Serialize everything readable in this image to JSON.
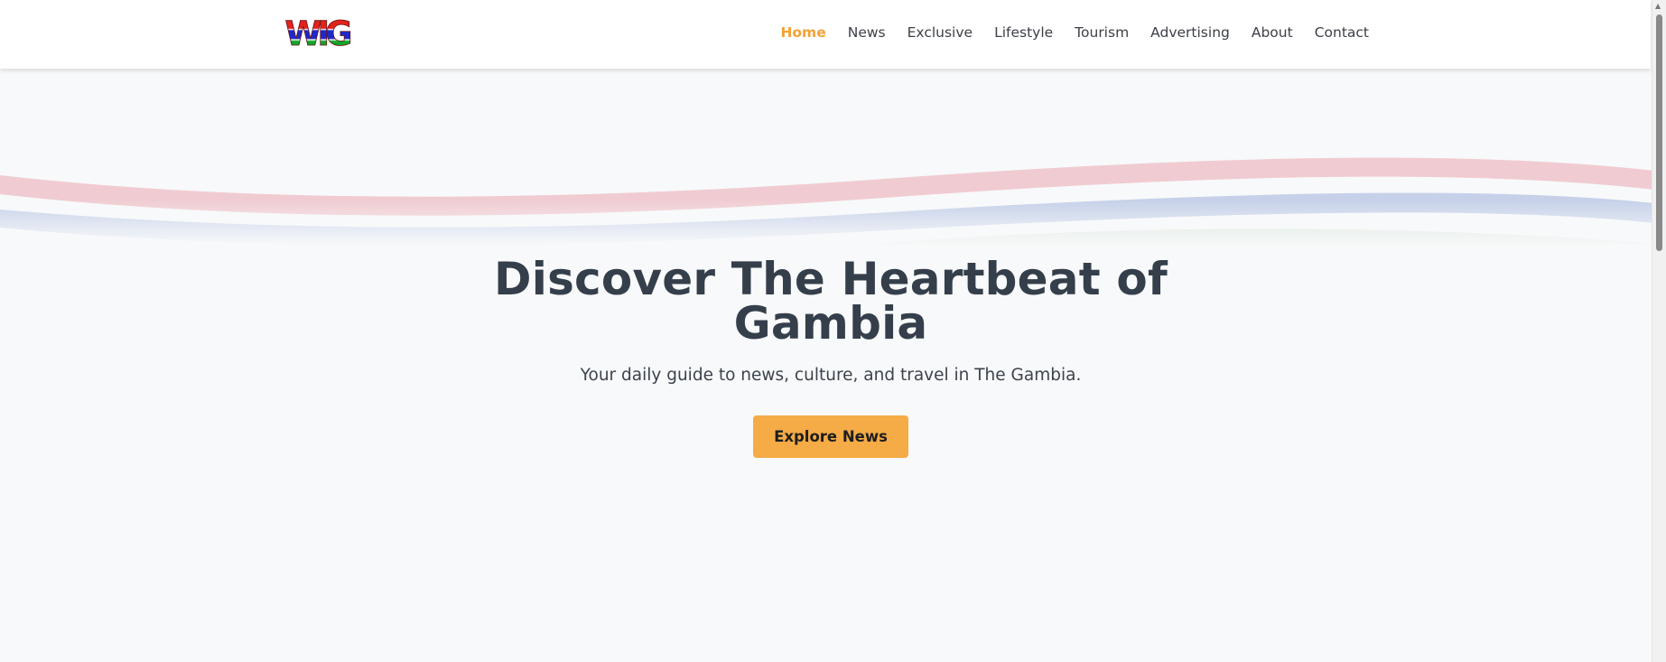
{
  "logo": {
    "text": "WIG",
    "colors": {
      "red": "#e0231b",
      "blue": "#1f29c8",
      "green": "#14a52a"
    }
  },
  "nav": {
    "items": [
      {
        "label": "Home",
        "active": true
      },
      {
        "label": "News",
        "active": false
      },
      {
        "label": "Exclusive",
        "active": false
      },
      {
        "label": "Lifestyle",
        "active": false
      },
      {
        "label": "Tourism",
        "active": false
      },
      {
        "label": "Advertising",
        "active": false
      },
      {
        "label": "About",
        "active": false
      },
      {
        "label": "Contact",
        "active": false
      }
    ]
  },
  "hero": {
    "title": "Discover The Heartbeat of Gambia",
    "subtitle": "Your daily guide to news, culture, and travel in The Gambia.",
    "cta_label": "Explore News"
  },
  "colors": {
    "accent": "#f4a236",
    "button": "#f5ab46",
    "wave_red": "#f0ccd2",
    "wave_blue": "#c6d1e9",
    "wave_green": "#d2e1d4"
  }
}
